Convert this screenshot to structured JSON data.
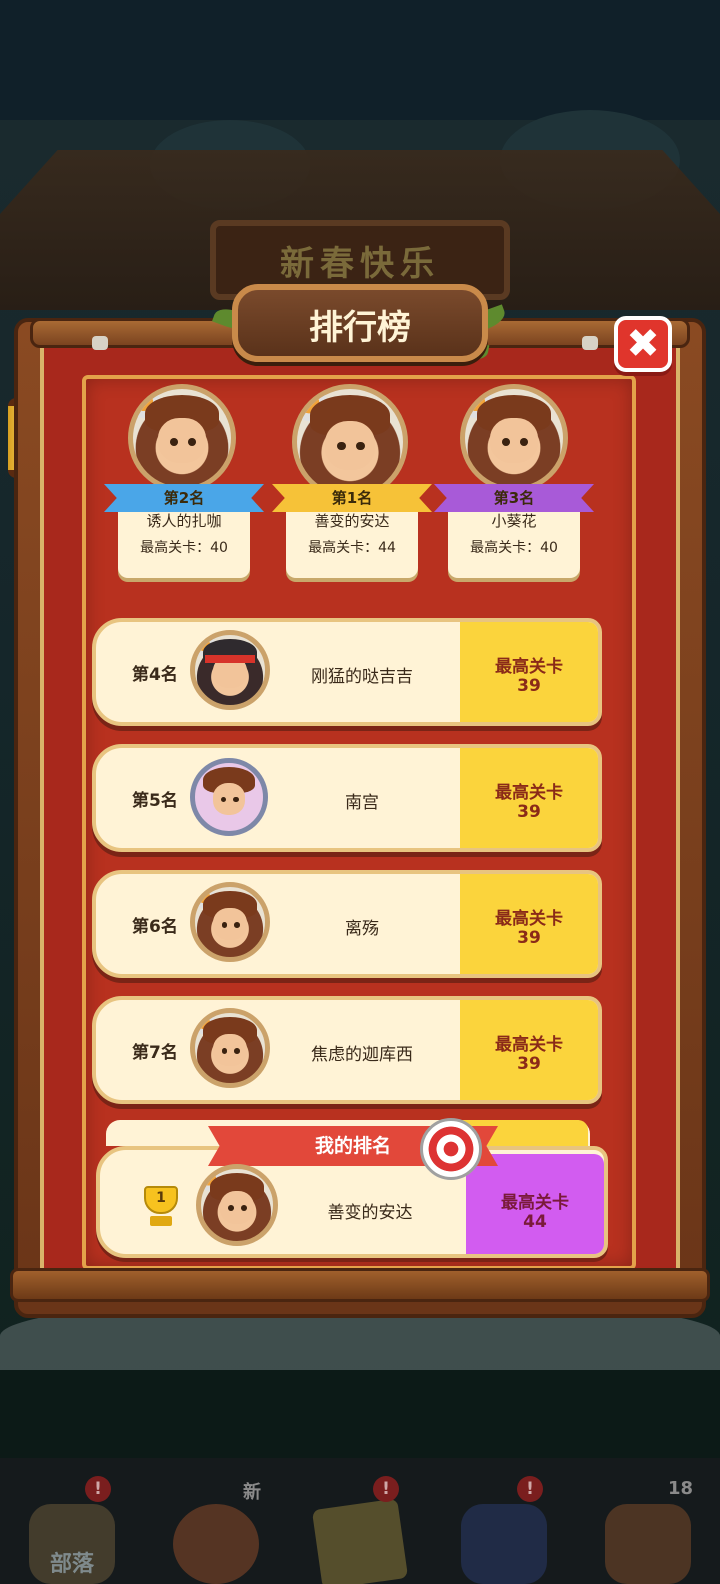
{
  "background": {
    "sign_text": "新春快乐"
  },
  "title": "排行榜",
  "close_label": "✖",
  "podium": [
    {
      "rank_label": "第2名",
      "name": "诱人的扎咖",
      "level_text": "最高关卡：40",
      "ribbon_color": "#4aa6e8"
    },
    {
      "rank_label": "第1名",
      "name": "善变的安达",
      "level_text": "最高关卡：44",
      "ribbon_color": "#f6c238"
    },
    {
      "rank_label": "第3名",
      "name": "小葵花",
      "level_text": "最高关卡：40",
      "ribbon_color": "#a85ad8"
    }
  ],
  "rankings": [
    {
      "rank": "第4名",
      "name": "刚猛的哒吉吉",
      "level_label": "最高关卡",
      "level": "39"
    },
    {
      "rank": "第5名",
      "name": "南宫",
      "level_label": "最高关卡",
      "level": "39"
    },
    {
      "rank": "第6名",
      "name": "离殇",
      "level_label": "最高关卡",
      "level": "39"
    },
    {
      "rank": "第7名",
      "name": "焦虑的迦库西",
      "level_label": "最高关卡",
      "level": "39"
    }
  ],
  "my_rank": {
    "banner": "我的排名",
    "rank": "1",
    "name": "善变的安达",
    "level_label": "最高关卡",
    "level": "44"
  },
  "bottom_nav": [
    {
      "label": "部落",
      "badge": "!",
      "icon": "tribe-icon"
    },
    {
      "label": "",
      "badge": "新",
      "icon": "hero-icon"
    },
    {
      "label": "",
      "badge": "!",
      "icon": "map-icon"
    },
    {
      "label": "",
      "badge": "!",
      "icon": "pet-icon"
    },
    {
      "label": "",
      "badge": "18",
      "icon": "shop-icon"
    }
  ],
  "colors": {
    "accent_yellow": "#fbd43c",
    "my_level_purple": "#d25cf0",
    "board_red": "#b8311f",
    "close_red": "#e0352c"
  }
}
